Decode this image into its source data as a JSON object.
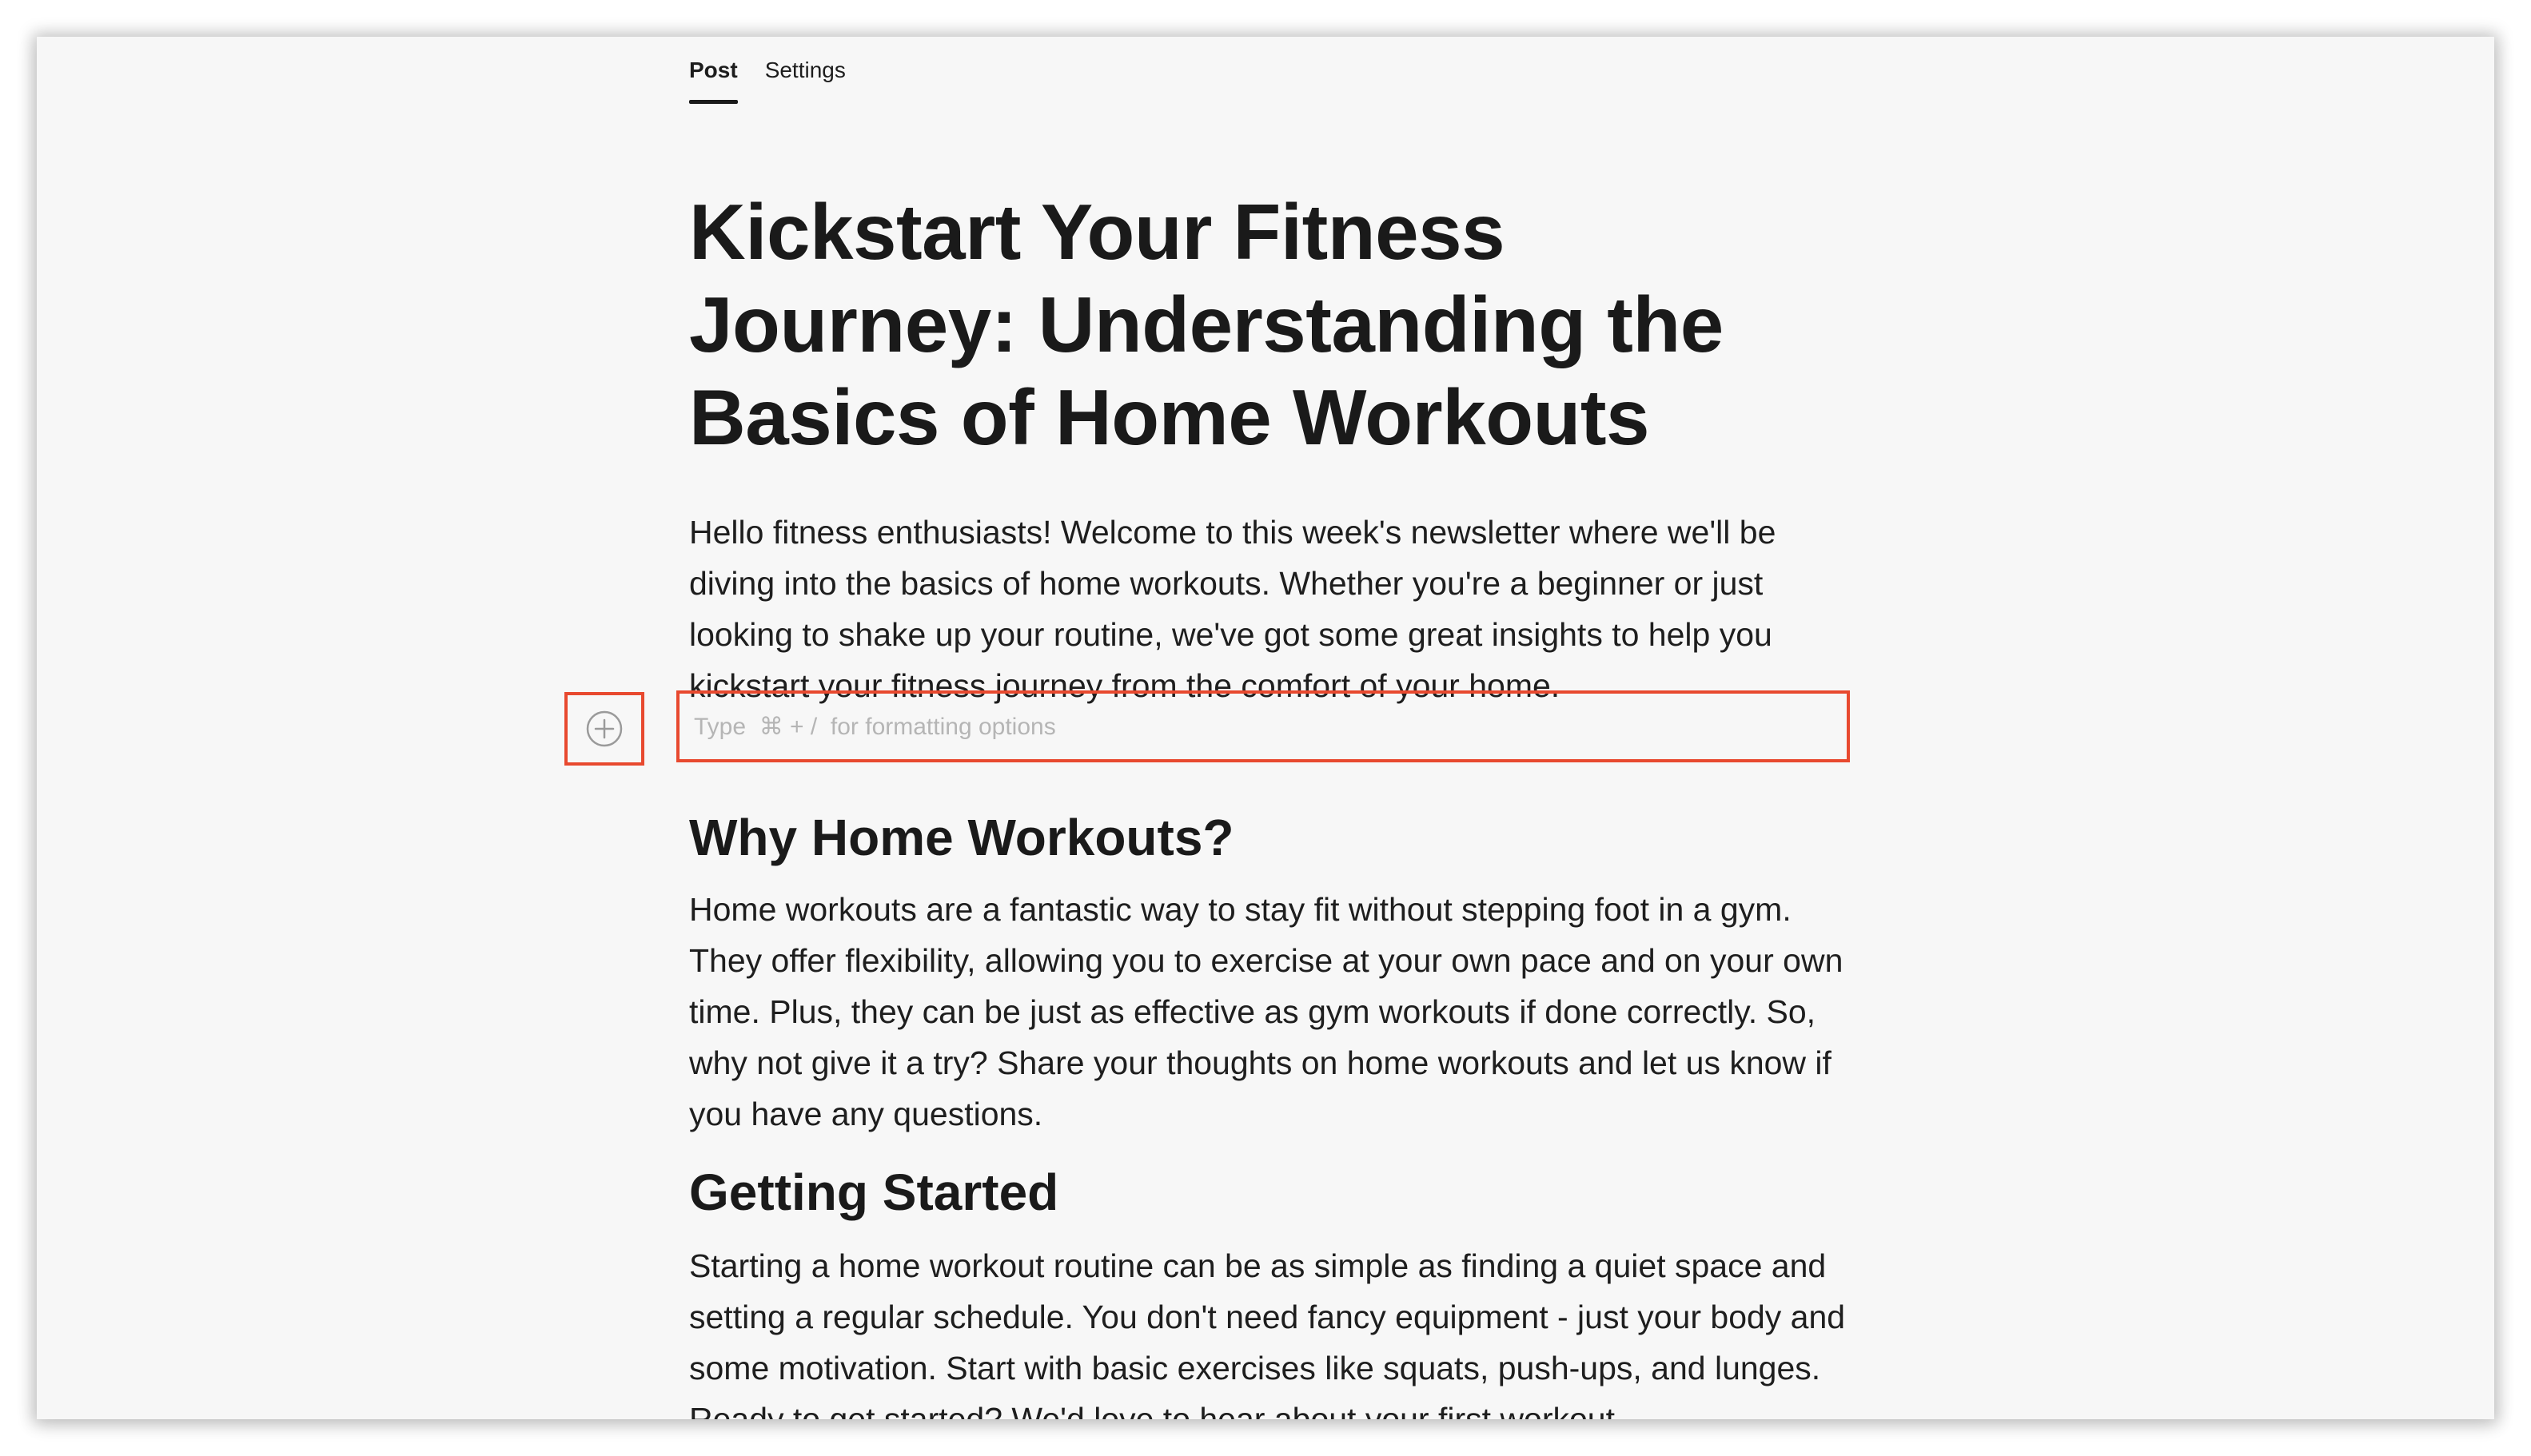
{
  "tabs": [
    {
      "label": "Post",
      "active": true
    },
    {
      "label": "Settings",
      "active": false
    }
  ],
  "post": {
    "title": "Kickstart Your Fitness Journey: Understanding the Basics of Home Workouts",
    "intro": "Hello fitness enthusiasts! Welcome to this week's newsletter where we'll be diving into the basics of home workouts. Whether you're a beginner or just looking to shake up your routine, we've got some great insights to help you kickstart your fitness journey from the comfort of your home.",
    "editor_placeholder": "Type  ⌘ + /  for formatting options",
    "sections": [
      {
        "heading": "Why Home Workouts?",
        "body": "Home workouts are a fantastic way to stay fit without stepping foot in a gym. They offer flexibility, allowing you to exercise at your own pace and on your own time. Plus, they can be just as effective as gym workouts if done correctly. So, why not give it a try? Share your thoughts on home workouts and let us know if you have any questions."
      },
      {
        "heading": "Getting Started",
        "body": "Starting a home workout routine can be as simple as finding a quiet space and setting a regular schedule. You don't need fancy equipment - just your body and some motivation. Start with basic exercises like squats, push-ups, and lunges. Ready to get started? We'd love to hear about your first workout"
      }
    ]
  },
  "icons": {
    "add_block": "plus-circle-icon"
  },
  "colors": {
    "highlight": "#e8492f",
    "text": "#1a1a1a",
    "placeholder": "#b5b5b5",
    "background": "#f7f7f7"
  }
}
